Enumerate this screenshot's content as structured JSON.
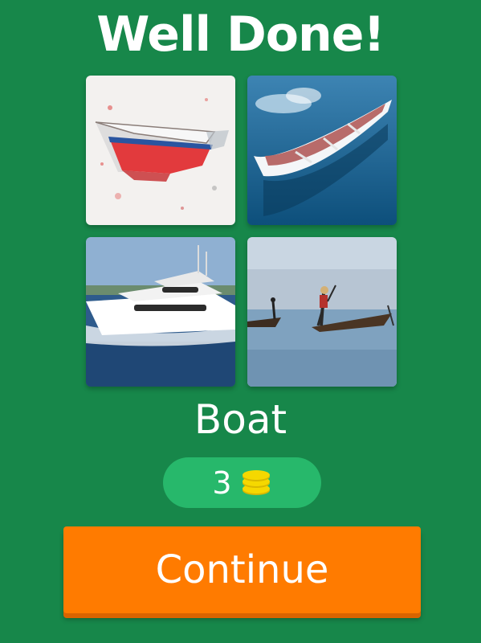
{
  "header": {
    "title": "Well Done!"
  },
  "puzzle": {
    "images": [
      {
        "icon": "watercolor-boat-image"
      },
      {
        "icon": "rowboat-on-water-image"
      },
      {
        "icon": "white-yacht-image"
      },
      {
        "icon": "fishermen-boats-image"
      }
    ],
    "answer": "Boat"
  },
  "reward": {
    "count": "3",
    "icon": "coins-icon"
  },
  "actions": {
    "continue_label": "Continue"
  },
  "colors": {
    "background": "#17874a",
    "pill": "#27b86b",
    "button": "#ff7b00",
    "coin": "#f5d800"
  }
}
